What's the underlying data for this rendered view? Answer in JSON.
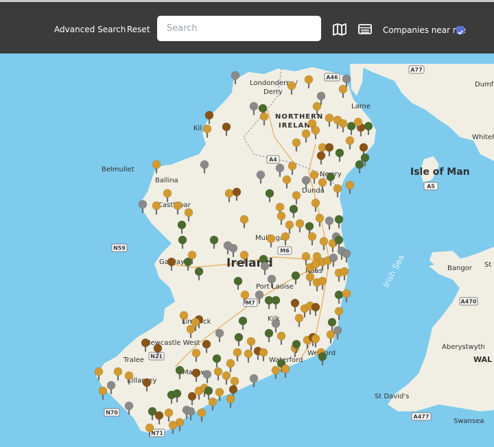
{
  "header": {
    "advanced_search_label": "Advanced Search",
    "reset_label": "Reset",
    "search_placeholder": "Search",
    "search_value": "",
    "map_view_icon": "map-icon",
    "list_view_icon": "list-icon",
    "near_me_label": "Companies near me",
    "near_me_checked": true
  },
  "map": {
    "place_labels": {
      "londonderry": "Londonderry /",
      "derry": "Derry",
      "larne": "Larne",
      "northern": "NORTHERN",
      "ireland_ni": "IRELAND",
      "belmullet": "Belmullet",
      "ballina": "Ballina",
      "castlebar": "Castlebar",
      "kilrea": "Kil",
      "newry": "Newry",
      "dundalk": "Dunda",
      "mullingar": "Mullingar",
      "ireland": "Ireland",
      "galway": "Galway",
      "port_laoise": "Port Laoise",
      "limerick": "Limerick",
      "newcastle_west": "Newcastle West",
      "tralee": "Tralee",
      "killarney": "Killarney",
      "mallow": "Mallow",
      "waterford": "Waterford",
      "wexford": "Wexford",
      "isle_of_man": "Isle of Man",
      "irish_sea": "Irish Sea",
      "bangor": "Bangor",
      "aberystwyth": "Aberystwyth",
      "wales": "WAL",
      "st_davids": "St David's",
      "swansea": "Swansea",
      "dumfries": "Dumfr",
      "whitehaven": "Whiteh",
      "st": "St",
      "kilkenny": "Kilk",
      "naas": "Naas"
    },
    "road_shields": [
      "A46",
      "A77",
      "A4",
      "N59",
      "M6",
      "M7",
      "N21",
      "N70",
      "N71",
      "A5",
      "A470",
      "A477"
    ],
    "colors": {
      "sea": "#7ecbee",
      "land": "#f1efe4",
      "pin_gold": "#d39a2f",
      "pin_brown": "#8a5416",
      "pin_green": "#4b6b2c",
      "pin_gray": "#8a8a8a"
    }
  }
}
